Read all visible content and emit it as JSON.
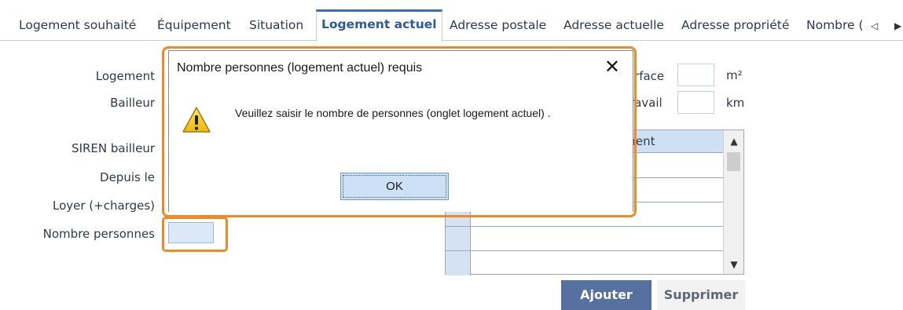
{
  "tabs": [
    {
      "label": "Logement souhaité"
    },
    {
      "label": "Équipement"
    },
    {
      "label": "Situation"
    },
    {
      "label": "Logement actuel"
    },
    {
      "label": "Adresse postale"
    },
    {
      "label": "Adresse actuelle"
    },
    {
      "label": "Adresse propriété"
    },
    {
      "label": "Nombre ("
    }
  ],
  "tab_nav": {
    "prev_glyph": "◁",
    "next_glyph": "▶"
  },
  "form": {
    "logement_label": "Logement",
    "bailleur_label": "Bailleur",
    "siren_label": "SIREN bailleur",
    "depuis_label": "Depuis le",
    "loyer_label": "Loyer (+charges)",
    "nombre_personnes_label": "Nombre personnes",
    "surface_label": "Surface",
    "surface_unit": "m²",
    "travail_label": "/travail",
    "travail_unit": "km"
  },
  "grid": {
    "header": "ement",
    "rows": 5
  },
  "buttons": {
    "add": "Ajouter",
    "delete": "Supprimer"
  },
  "dialog": {
    "title": "Nombre personnes (logement actuel) requis",
    "close_glyph": "✕",
    "message": "Veuillez saisir le nombre de personnes (onglet logement actuel) .",
    "ok": "OK",
    "icon": "warning-icon"
  },
  "colors": {
    "highlight_orange": "#ef8a28",
    "active_tab_blue": "#3a6fb7",
    "primary_button": "#5671a0"
  }
}
